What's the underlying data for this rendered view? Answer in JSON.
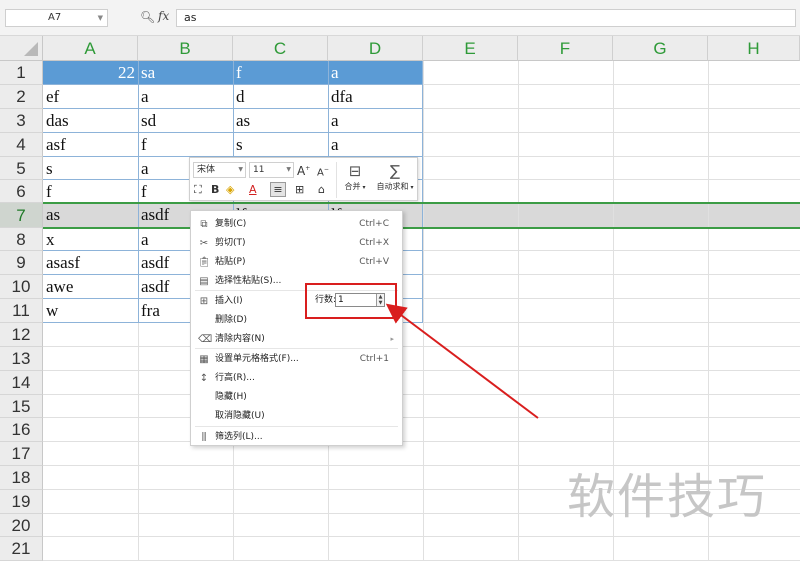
{
  "formula_bar": {
    "name_box": "A7",
    "fx_label": "fx",
    "formula_value": "as"
  },
  "columns": [
    "A",
    "B",
    "C",
    "D",
    "E",
    "F",
    "G",
    "H"
  ],
  "rows": [
    "1",
    "2",
    "3",
    "4",
    "5",
    "6",
    "7",
    "8",
    "9",
    "10",
    "11",
    "12",
    "13",
    "14",
    "15",
    "16",
    "17",
    "18",
    "19",
    "20",
    "21"
  ],
  "selected_row": "7",
  "cells": [
    [
      "22",
      "sa",
      "f",
      "a"
    ],
    [
      "ef",
      "a",
      "d",
      "dfa"
    ],
    [
      "das",
      "sd",
      "as",
      "a"
    ],
    [
      "asf",
      "f",
      "s",
      "a"
    ],
    [
      "s",
      "a",
      "",
      ""
    ],
    [
      "f",
      "f",
      "",
      ""
    ],
    [
      "as",
      "asdf",
      "lf",
      "lf"
    ],
    [
      "x",
      "a",
      "",
      ""
    ],
    [
      "asasf",
      "asdf",
      "",
      ""
    ],
    [
      "awe",
      "asdf",
      "",
      ""
    ],
    [
      "w",
      "fra",
      "",
      ""
    ]
  ],
  "mini_toolbar": {
    "font_name": "宋体",
    "font_size": "11",
    "merge_label": "合并",
    "autosum_label": "自动求和"
  },
  "context_menu": {
    "items": [
      {
        "label": "复制(C)",
        "shortcut": "Ctrl+C",
        "icon": "copy-icon"
      },
      {
        "label": "剪切(T)",
        "shortcut": "Ctrl+X",
        "icon": "scissors-icon"
      },
      {
        "label": "粘贴(P)",
        "shortcut": "Ctrl+V",
        "icon": "paste-icon"
      },
      {
        "label": "选择性粘贴(S)...",
        "shortcut": "",
        "icon": "paste-special-icon"
      },
      {
        "label": "插入(I)",
        "shortcut": "",
        "icon": "insert-row-icon"
      },
      {
        "label": "删除(D)",
        "shortcut": "",
        "icon": ""
      },
      {
        "label": "清除内容(N)",
        "shortcut": "",
        "icon": "eraser-icon"
      },
      {
        "label": "设置单元格格式(F)...",
        "shortcut": "Ctrl+1",
        "icon": "format-cells-icon"
      },
      {
        "label": "行高(R)...",
        "shortcut": "",
        "icon": "row-height-icon"
      },
      {
        "label": "隐藏(H)",
        "shortcut": "",
        "icon": ""
      },
      {
        "label": "取消隐藏(U)",
        "shortcut": "",
        "icon": ""
      },
      {
        "label": "筛选列(L)...",
        "shortcut": "",
        "icon": "filter-column-icon"
      }
    ],
    "rows_label": "行数:",
    "rows_value": "1"
  },
  "watermark": "软件技巧",
  "colors": {
    "header_fill": "#5b9bd5",
    "column_header_text": "#2e9a38",
    "selection": "#3c9c45",
    "annotation": "#d91e1e"
  }
}
